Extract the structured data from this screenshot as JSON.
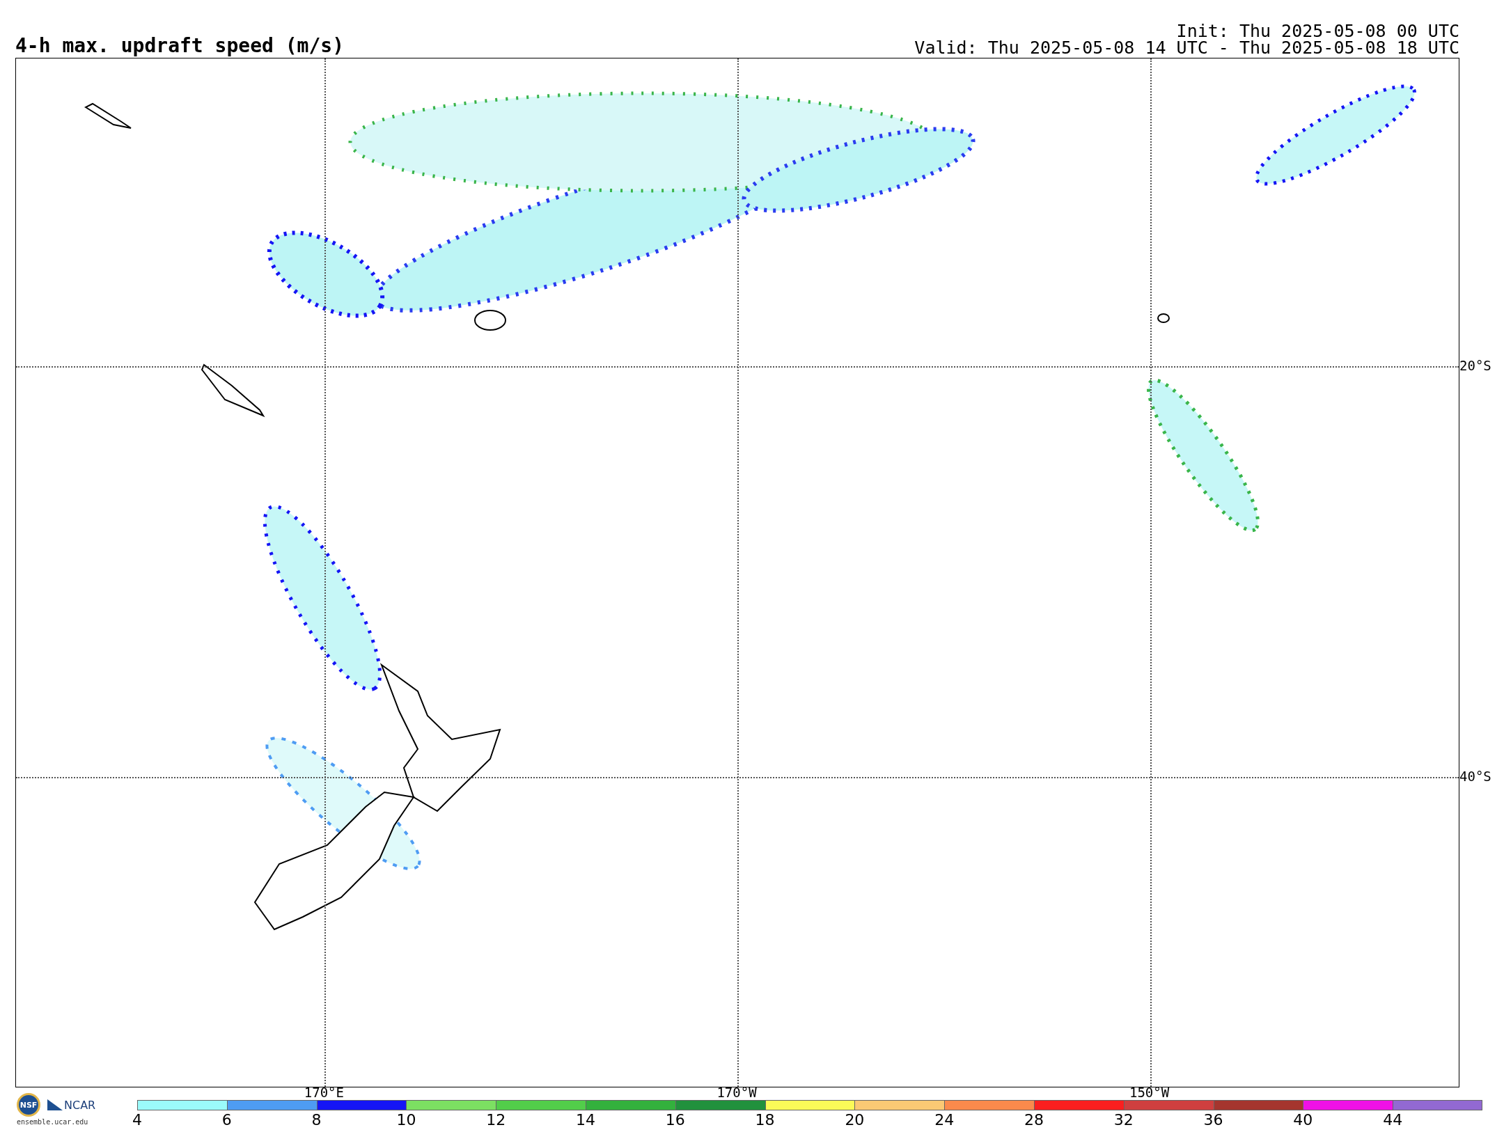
{
  "title": "4-h max. updraft speed (m/s)",
  "init": "Init: Thu 2025-05-08 00 UTC",
  "valid": "Valid: Thu 2025-05-08 14 UTC - Thu 2025-05-08 18 UTC",
  "map": {
    "lat_labels": [
      "20°S",
      "40°S"
    ],
    "lon_labels": [
      "170°E",
      "170°W",
      "150°W"
    ]
  },
  "logo": {
    "badge": "NSF",
    "name": "NCAR",
    "url": "ensemble.ucar.edu"
  },
  "colorbar": [
    {
      "label": "4",
      "color": "#9bfbfb"
    },
    {
      "label": "6",
      "color": "#4e9cf3"
    },
    {
      "label": "8",
      "color": "#1515f5"
    },
    {
      "label": "10",
      "color": "#7ce062"
    },
    {
      "label": "12",
      "color": "#52cd4a"
    },
    {
      "label": "14",
      "color": "#33b13d"
    },
    {
      "label": "16",
      "color": "#21913d"
    },
    {
      "label": "18",
      "color": "#fbfb58"
    },
    {
      "label": "20",
      "color": "#fbc974"
    },
    {
      "label": "24",
      "color": "#fb8a4c"
    },
    {
      "label": "28",
      "color": "#fb1f1f"
    },
    {
      "label": "32",
      "color": "#cf3f3f"
    },
    {
      "label": "36",
      "color": "#a5352e"
    },
    {
      "label": "40",
      "color": "#f011e6"
    },
    {
      "label": "44",
      "color": "#9269d2"
    }
  ]
}
